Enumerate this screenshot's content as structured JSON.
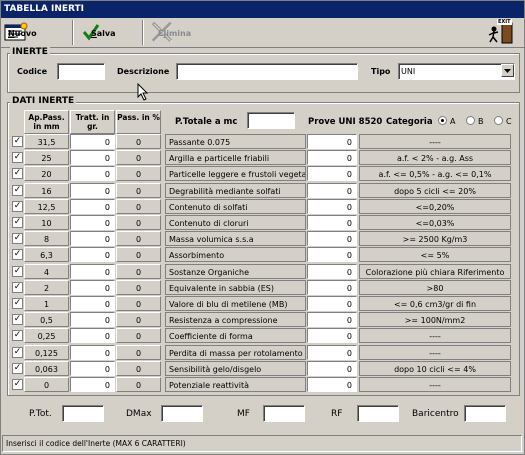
{
  "window": {
    "title": "TABELLA INERTI"
  },
  "toolbar": {
    "nuovo": {
      "pre": "",
      "key": "N",
      "post": "uovo"
    },
    "salva": {
      "pre": "",
      "key": "S",
      "post": "alva"
    },
    "elimina": {
      "pre": "E",
      "key": "l",
      "post": "imina"
    }
  },
  "inerte": {
    "legend": "INERTE",
    "codice_label": "Codice",
    "codice_value": "",
    "descrizione_label": "Descrizione",
    "descrizione_value": "",
    "tipo_label": "Tipo",
    "tipo_value": "UNI"
  },
  "dati": {
    "legend": "DATI INERTE",
    "col_ap": "Ap.Pass. in mm",
    "col_tratt": "Tratt. in gr.",
    "col_pass": "Pass. in %",
    "ptotale_label": "P.Totale a mc",
    "ptotale_value": "",
    "prove_label": "Prove UNI 8520",
    "categoria_label": "Categoria",
    "categorie": [
      "A",
      "B",
      "C"
    ],
    "categoria_selected": "A",
    "rows": [
      {
        "checked": true,
        "ap": "31,5",
        "tratt": "0",
        "pass": "0",
        "prova": "Passante 0.075",
        "prova_val": "0",
        "limite": "----"
      },
      {
        "checked": true,
        "ap": "25",
        "tratt": "0",
        "pass": "0",
        "prova": "Argilla e particelle friabili",
        "prova_val": "0",
        "limite": "a.f. < 2% - a.g. Ass"
      },
      {
        "checked": true,
        "ap": "20",
        "tratt": "0",
        "pass": "0",
        "prova": "Particelle leggere e frustoli vegetali",
        "prova_val": "0",
        "limite": "a.f. <= 0,5% - a.g. <= 0,1%"
      },
      {
        "checked": true,
        "ap": "16",
        "tratt": "0",
        "pass": "0",
        "prova": "Degrabilità mediante solfati",
        "prova_val": "0",
        "limite": "dopo 5 cicli <= 20%"
      },
      {
        "checked": true,
        "ap": "12,5",
        "tratt": "0",
        "pass": "0",
        "prova": "Contenuto di solfati",
        "prova_val": "0",
        "limite": "<=0,20%"
      },
      {
        "checked": true,
        "ap": "10",
        "tratt": "0",
        "pass": "0",
        "prova": "Contenuto di cloruri",
        "prova_val": "0",
        "limite": "<=0,03%"
      },
      {
        "checked": true,
        "ap": "8",
        "tratt": "0",
        "pass": "0",
        "prova": "Massa volumica s.s.a",
        "prova_val": "0",
        "limite": ">= 2500 Kg/m3"
      },
      {
        "checked": true,
        "ap": "6,3",
        "tratt": "0",
        "pass": "0",
        "prova": "Assorbimento",
        "prova_val": "0",
        "limite": "<= 5%"
      },
      {
        "checked": true,
        "ap": "4",
        "tratt": "0",
        "pass": "0",
        "prova": "Sostanze Organiche",
        "prova_val": "0",
        "limite": "Colorazione più chiara Riferimento"
      },
      {
        "checked": true,
        "ap": "2",
        "tratt": "0",
        "pass": "0",
        "prova": "Equivalente in sabbia (ES)",
        "prova_val": "0",
        "limite": ">80"
      },
      {
        "checked": true,
        "ap": "1",
        "tratt": "0",
        "pass": "0",
        "prova": "Valore di blu di metilene (MB)",
        "prova_val": "0",
        "limite": "<= 0,6 cm3/gr di fin"
      },
      {
        "checked": true,
        "ap": "0,5",
        "tratt": "0",
        "pass": "0",
        "prova": "Resistenza a compressione",
        "prova_val": "0",
        "limite": ">= 100N/mm2"
      },
      {
        "checked": true,
        "ap": "0,25",
        "tratt": "0",
        "pass": "0",
        "prova": "Coefficiente di forma",
        "prova_val": "0",
        "limite": "----"
      },
      {
        "checked": true,
        "ap": "0,125",
        "tratt": "0",
        "pass": "0",
        "prova": "Perdita di massa per rotolamento",
        "prova_val": "0",
        "limite": "----"
      },
      {
        "checked": true,
        "ap": "0,063",
        "tratt": "0",
        "pass": "0",
        "prova": "Sensibilità gelo/disgelo",
        "prova_val": "0",
        "limite": "dopo 10 cicli <= 4%"
      },
      {
        "checked": true,
        "ap": "0",
        "tratt": "0",
        "pass": "0",
        "prova": "Potenziale reattività",
        "prova_val": "0",
        "limite": "----"
      }
    ]
  },
  "footer": [
    {
      "label": "P.Tot.",
      "value": ""
    },
    {
      "label": "DMax",
      "value": ""
    },
    {
      "label": "MF",
      "value": ""
    },
    {
      "label": "RF",
      "value": ""
    },
    {
      "label": "Baricentro",
      "value": ""
    }
  ],
  "status": "Inserisci il codice dell'Inerte (MAX 6 CARATTERI)",
  "exit_icon_text": "EXIT"
}
